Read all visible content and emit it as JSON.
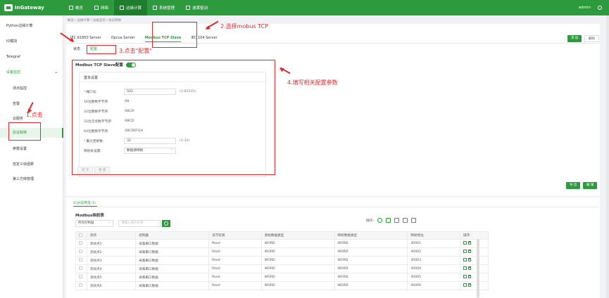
{
  "app": {
    "name": "InGateway",
    "user": "admin"
  },
  "nav": [
    {
      "label": "概览"
    },
    {
      "label": "网络"
    },
    {
      "label": "边缘计算"
    },
    {
      "label": "系统管理"
    },
    {
      "label": "迪莱驱动"
    }
  ],
  "sidebar": {
    "items": [
      {
        "label": "Python边缘计算"
      },
      {
        "label": "IO模块"
      },
      {
        "label": "Telegraf"
      },
      {
        "label": "设备监控"
      },
      {
        "label": "测点监控"
      },
      {
        "label": "告警"
      },
      {
        "label": "云服务"
      },
      {
        "label": "协议转换"
      },
      {
        "label": "参数设置"
      },
      {
        "label": "自定义快函数"
      },
      {
        "label": "第三方库管理"
      }
    ]
  },
  "breadcrumb": "概览 / 边缘计算 / 设备监控 / 协议转换",
  "protocol_tabs": [
    {
      "label": "IEC 61850 Server"
    },
    {
      "label": "Opcua Server"
    },
    {
      "label": "Modbus TCP Slave"
    },
    {
      "label": "IEC 104 Server"
    }
  ],
  "actions": {
    "add": "添 加",
    "delete": "删除"
  },
  "sub_tabs": [
    {
      "label": "状态"
    },
    {
      "label": "配置"
    }
  ],
  "config": {
    "title": "Modbus TCP Slave配置",
    "section": "基本设置",
    "fields": [
      {
        "label": "端口号:",
        "value": "502",
        "hint": "(1-65535)"
      },
      {
        "label": "16位整数字节序:",
        "value": "AB"
      },
      {
        "label": "32位整数字节序:",
        "value": "ABCD"
      },
      {
        "label": "32位浮点数字节序:",
        "value": "ABCD"
      },
      {
        "label": "64位整数字节序:",
        "value": "ABCDEFGH"
      },
      {
        "label": "最大连接数:",
        "value": "32",
        "hint": "(1-32)"
      },
      {
        "label": "映射表设置:",
        "value": "数据源映射"
      }
    ],
    "submit": "提 交",
    "reset": "重 置"
  },
  "mapping": {
    "tab": "1(从站地址:1)",
    "title": "Modbus映射表",
    "import": "导 出",
    "edit": "编 辑",
    "filter_select": "所有控制器",
    "search_placeholder": "请输入测点名字",
    "ops_label": "操作:",
    "columns": [
      "测点",
      "控制器",
      "读写权限",
      "源始数据类型",
      "映射数据类型",
      "映射地址",
      "操作"
    ],
    "rows": [
      [
        "测试点1",
        "采集串口数据",
        "Read",
        "WORD",
        "WORD",
        "40001"
      ],
      [
        "测试点2",
        "采集串口数据",
        "Read",
        "WORD",
        "WORD",
        "40002"
      ],
      [
        "测试点3",
        "采集串口数据",
        "Read",
        "WORD",
        "WORD",
        "40003"
      ],
      [
        "测试点4",
        "采集串口数据",
        "Read",
        "WORD",
        "WORD",
        "40004"
      ],
      [
        "测试点5",
        "采集串口数据",
        "Read",
        "WORD",
        "WORD",
        "40005"
      ],
      [
        "测试点6",
        "采集串口数据",
        "Read",
        "WORD",
        "WORD",
        "40006"
      ]
    ]
  },
  "annotations": [
    {
      "text": "1.点击"
    },
    {
      "text": "2.选择mobus TCP"
    },
    {
      "text": "3.点击\"配置\""
    },
    {
      "text": "4.填写相关配置参数"
    }
  ],
  "colors": {
    "brand": "#2e9a3e",
    "annotation": "#e0292b"
  }
}
